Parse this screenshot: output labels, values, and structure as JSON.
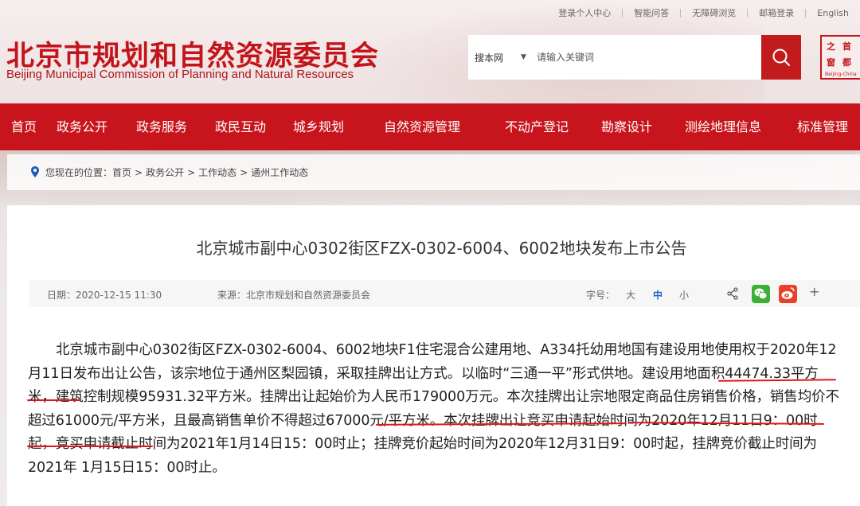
{
  "header": {
    "top_links": [
      "登录个人中心",
      "智能问答",
      "无障碍浏览",
      "邮箱登录",
      "English"
    ],
    "logo_cn": "北京市规划和自然资源委员会",
    "logo_en": "Beijing Municipal Commission of Planning and Natural Resources",
    "search": {
      "scope": "搜本网",
      "placeholder": "请输入关键词"
    },
    "seal": {
      "chars": [
        "之",
        "首",
        "窗",
        "都"
      ],
      "caption": "Beijing-China"
    }
  },
  "nav": {
    "items": [
      "首页",
      "政务公开",
      "政务服务",
      "政民互动",
      "城乡规划",
      "自然资源管理",
      "不动产登记",
      "勘察设计",
      "测绘地理信息",
      "标准管理"
    ]
  },
  "breadcrumb": {
    "prefix": "您现在的位置：",
    "items": [
      "首页",
      "政务公开",
      "工作动态",
      "通州工作动态"
    ],
    "separator": ">"
  },
  "article": {
    "title": "北京城市副中心0302街区FZX-0302-6004、6002地块发布上市公告",
    "meta": {
      "date": "日期：2020-12-15 11:30",
      "source": "来源：北京市规划和自然资源委员会",
      "font_size_label": "字号：",
      "font_sizes": [
        "大",
        "中",
        "小"
      ],
      "active_font_size": "中",
      "more": "+"
    },
    "body": {
      "s1": "北京城市副中心0302街区FZX-0302-6004、6002地块F1住宅混合公建用地、A334托幼用地国有建设用地使用权于2020年12月11日发布出让公告，该宗地位于通州区梨园镇，采取挂牌出让方式。以临时",
      "s2": "“三通一平”形式供地",
      "s3": "。建设用地面积44474.33平方米，建筑控制规模95931.32平方米。挂牌出让起始价为人民币179000万元。本次挂牌出让宗地限定商品住房销售价格，",
      "s4": "销售均价不超过61000元/平方米，",
      "s5": "且最高销售单价不得超过67000元/平方米",
      "s6": "。本次挂牌出让竞买申请起始时间为2020年12月11日9：00时起，竞买申请截止时间为2021年1月14日15：00时止；挂牌竞价起始时间为2020年12月31日9：00时起，挂牌竞价截止时间为2021年 1月15日15：00时止。"
    }
  },
  "colors": {
    "brand_red": "#c8151d",
    "underline_red": "#e1161c",
    "link_blue": "#2166c4"
  }
}
